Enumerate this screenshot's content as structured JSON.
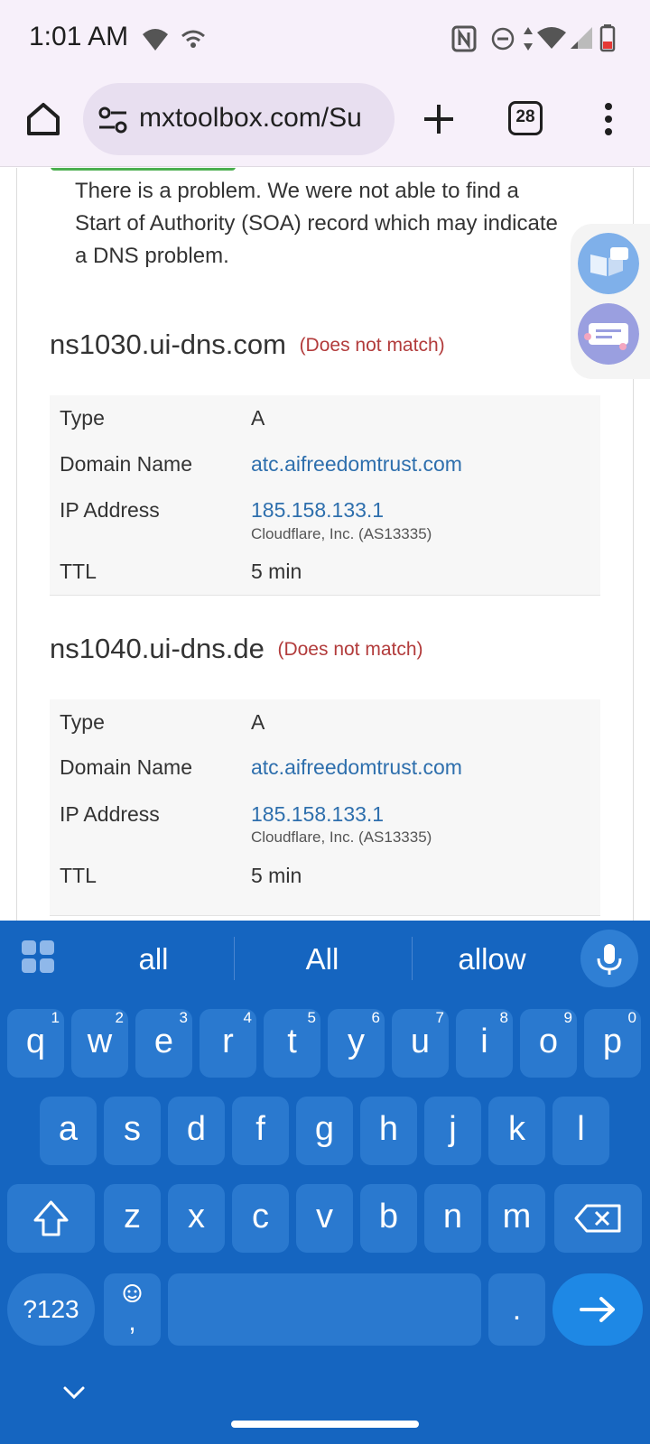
{
  "status_bar": {
    "time": "1:01 AM"
  },
  "browser": {
    "url": "mxtoolbox.com/Su",
    "tab_count": "28"
  },
  "page": {
    "problem_text": "There is a problem. We were not able to find a Start of Authority (SOA) record which may indicate a DNS problem.",
    "sections": [
      {
        "server": "ns1030.ui-dns.com",
        "status": "(Does not match)",
        "rows": [
          {
            "label": "Type",
            "value": "A"
          },
          {
            "label": "Domain Name",
            "value": "atc.aifreedomtrust.com"
          },
          {
            "label": "IP Address",
            "value": "185.158.133.1",
            "sub": "Cloudflare, Inc. (AS13335)"
          },
          {
            "label": "TTL",
            "value": "5 min"
          }
        ]
      },
      {
        "server": "ns1040.ui-dns.de",
        "status": "(Does not match)",
        "rows": [
          {
            "label": "Type",
            "value": "A"
          },
          {
            "label": "Domain Name",
            "value": "atc.aifreedomtrust.com"
          },
          {
            "label": "IP Address",
            "value": "185.158.133.1",
            "sub": "Cloudflare, Inc. (AS13335)"
          },
          {
            "label": "TTL",
            "value": "5 min"
          }
        ]
      }
    ]
  },
  "keyboard": {
    "suggestions": [
      "all",
      "All",
      "allow"
    ],
    "row1": [
      "q",
      "w",
      "e",
      "r",
      "t",
      "y",
      "u",
      "i",
      "o",
      "p"
    ],
    "row1_hints": [
      "1",
      "2",
      "3",
      "4",
      "5",
      "6",
      "7",
      "8",
      "9",
      "0"
    ],
    "row2": [
      "a",
      "s",
      "d",
      "f",
      "g",
      "h",
      "j",
      "k",
      "l"
    ],
    "row3": [
      "z",
      "x",
      "c",
      "v",
      "b",
      "n",
      "m"
    ],
    "symbols_label": "?123",
    "comma": ",",
    "period": "."
  },
  "colors": {
    "keyboard_bg": "#1565c0",
    "key_bg": "#2a79cf",
    "link": "#2e6fad",
    "mismatch": "#b23b3b",
    "status_ok": "#4caf50"
  }
}
